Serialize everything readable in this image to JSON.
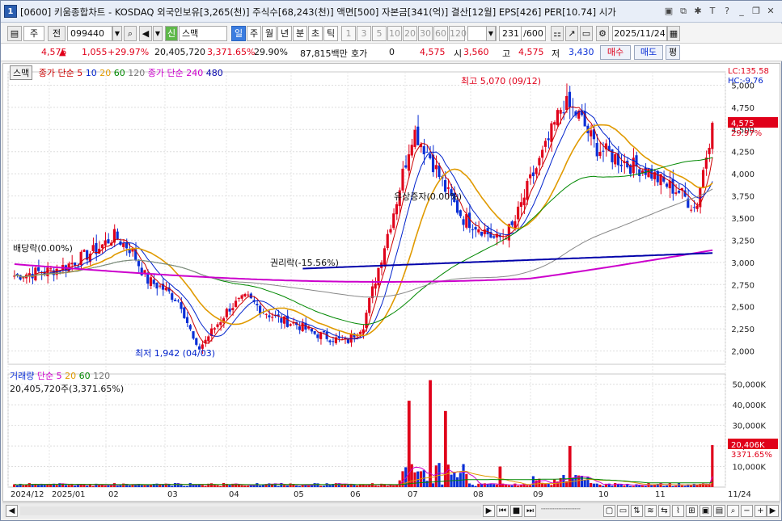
{
  "window": {
    "app_icon_label": "1",
    "title": "[0600] 키움종합차트 - KOSDAQ 외국인보유[3,265(천)] 주식수[68,243(천)] 액면[500] 자본금[341(억)] 결산[12월] EPS[426] PER[10.74] 시가",
    "icons": [
      "window-icon",
      "float-icon",
      "star-icon",
      "text-icon",
      "help-icon",
      "minimize-icon",
      "restore-icon",
      "close-icon"
    ]
  },
  "toolbar": {
    "market_select": "주",
    "prev_label": "전",
    "code": "099440",
    "sound_label": "◀",
    "new_label": "신",
    "name": "스맥",
    "periods": [
      "일",
      "주",
      "월",
      "년",
      "분",
      "초",
      "틱"
    ],
    "active_period": "일",
    "minute_options": [
      "1",
      "3",
      "5",
      "10",
      "20",
      "30",
      "60",
      "120"
    ],
    "count": "231",
    "count_total": "/600",
    "date": "2025/11/24"
  },
  "quote": {
    "price": "4,575",
    "change": "1,055",
    "change_pct": "+29.97%",
    "volume": "20,405,720",
    "vol_ratio": "3,371.65%",
    "turnover": "29.90%",
    "amount": "87,815백만",
    "ask_label": "호가",
    "ask_value": "0",
    "ask_price": "4,575",
    "open_label": "시",
    "open": "3,560",
    "high_label": "고",
    "high": "4,575",
    "low_label": "저",
    "low": "3,430",
    "buy_label": "매수",
    "sell_label": "매도",
    "eval_label": "평",
    "colors": {
      "up": "#e0001a",
      "down": "#0a2fd6"
    }
  },
  "legend": {
    "stock_name": "스맥",
    "ma_short_label": "종가 단순",
    "ma_short": [
      "5",
      "10",
      "20",
      "60",
      "120"
    ],
    "ma_long_label": "종가 단순",
    "ma_long": [
      "240",
      "480"
    ],
    "volume_label": "거래량",
    "vol_ma_label": "단순",
    "vol_ma": [
      "5",
      "20",
      "60",
      "120"
    ],
    "volume_summary": "20,405,720주(3,371.65%)"
  },
  "annotations": {
    "high": "최고 5,070 (09/12)",
    "low": "최저 1,942 (04/03)",
    "dividend": "배당락(0.00%)",
    "rights": "권리락(-15.56%)",
    "paid_in": "유상증자(0.00%)",
    "lc": "LC:135.58",
    "hc": "HC:-9.76",
    "price_tag": "4,575",
    "pct_tag": "29.97%",
    "vol_tag": "20,406K",
    "vol_pct_tag": "3371.65%"
  },
  "chart_data": {
    "type": "candlestick",
    "price_axis_ticks": [
      "5,000",
      "4,750",
      "4,500",
      "4,250",
      "4,000",
      "3,750",
      "3,500",
      "3,250",
      "3,000",
      "2,750",
      "2,500",
      "2,250",
      "2,000"
    ],
    "volume_axis_ticks": [
      "50,000K",
      "40,000K",
      "30,000K",
      "20,000K",
      "10,000K"
    ],
    "x_ticks": [
      "2024/12",
      "2025/01",
      "02",
      "03",
      "04",
      "05",
      "06",
      "07",
      "08",
      "09",
      "10",
      "11",
      "11/24"
    ],
    "close_path": [
      2850,
      2880,
      2900,
      2950,
      3050,
      3150,
      3300,
      3150,
      2800,
      2700,
      2550,
      2000,
      2250,
      2500,
      2600,
      2450,
      2350,
      2300,
      2200,
      2150,
      2100,
      2300,
      3000,
      3700,
      4500,
      4200,
      3800,
      3500,
      3400,
      3250,
      3400,
      3900,
      4300,
      4800,
      4650,
      4300,
      4200,
      4100,
      4050,
      3900,
      3800,
      3600,
      4575
    ]
  }
}
